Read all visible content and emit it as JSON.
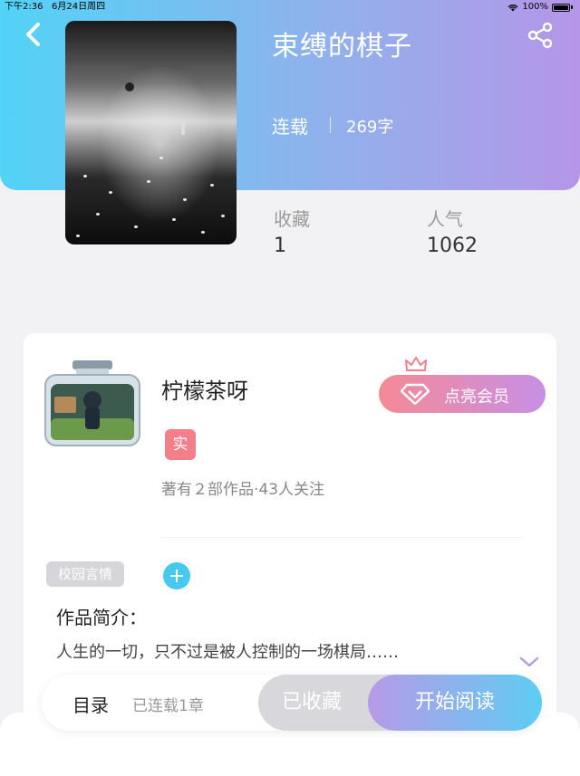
{
  "status_bar": {
    "time": "下午2:36",
    "date": "6月24日周四",
    "battery": "100%"
  },
  "colors": {
    "header_gradient_start": "#52d3f7",
    "header_gradient_end": "#b596e8",
    "vip_gradient_start": "#f58a95",
    "vip_gradient_end": "#c78fe6",
    "accent_blue": "#45c9ef"
  },
  "book": {
    "title": "束缚的棋子",
    "status": "连载",
    "word_count": "269字"
  },
  "stats": {
    "favorites_label": "收藏",
    "favorites_value": "1",
    "popularity_label": "人气",
    "popularity_value": "1062"
  },
  "author": {
    "name": "柠檬茶呀",
    "verified_badge": "实",
    "meta": "著有２部作品·43人关注",
    "vip_button": "点亮会员"
  },
  "tags": {
    "genre": "校园言情"
  },
  "intro": {
    "title": "作品简介：",
    "text": "人生的一切，只不过是被人控制的一场棋局……"
  },
  "bottom_bar": {
    "toc_label": "目录",
    "toc_sub": "已连载1章",
    "favorite_button": "已收藏",
    "read_button": "开始阅读"
  },
  "icons": {
    "back": "chevron-left-icon",
    "share": "share-icon",
    "vip_crown": "crown-icon",
    "vip_diamond": "diamond-icon",
    "add_tag": "plus-icon",
    "expand": "chevron-down-icon"
  }
}
